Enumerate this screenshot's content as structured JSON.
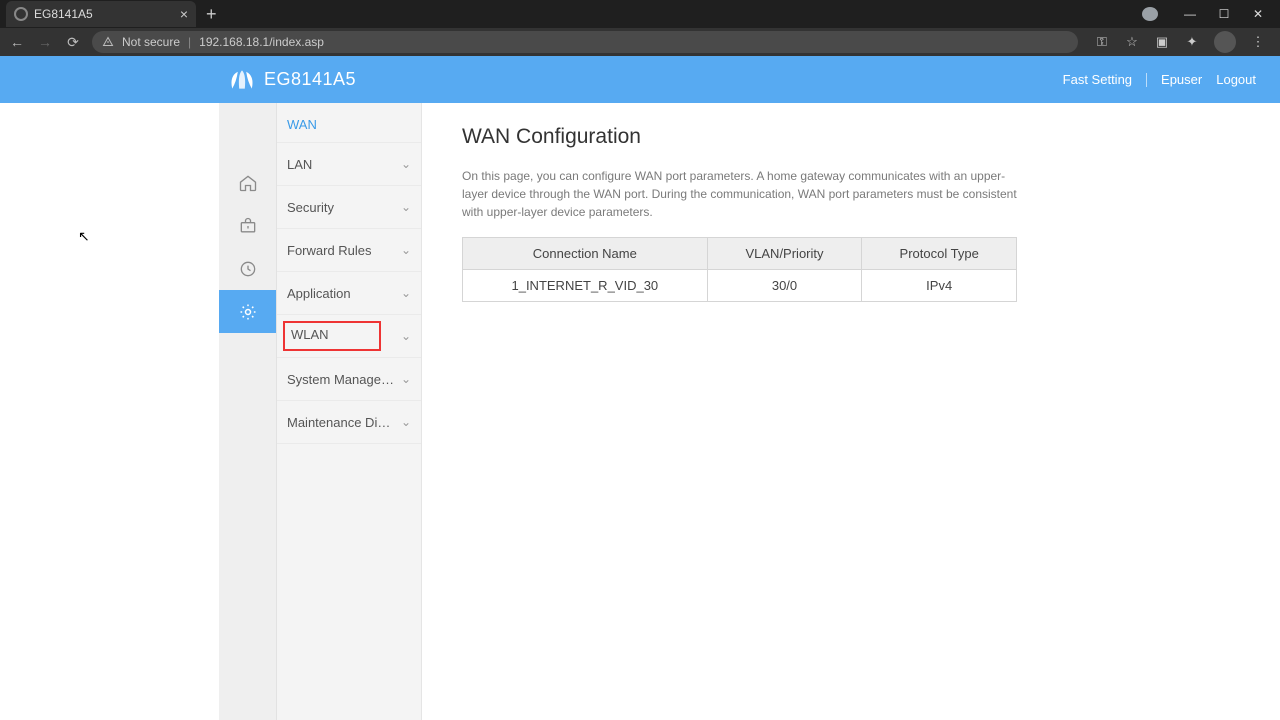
{
  "browser": {
    "tab_title": "EG8141A5",
    "security_label": "Not secure",
    "url": "192.168.18.1/index.asp"
  },
  "header": {
    "device": "EG8141A5",
    "links": {
      "fast": "Fast Setting",
      "user": "Epuser",
      "logout": "Logout"
    }
  },
  "sidenav": {
    "items": [
      {
        "label": "WAN",
        "active": true
      },
      {
        "label": "LAN"
      },
      {
        "label": "Security"
      },
      {
        "label": "Forward Rules"
      },
      {
        "label": "Application"
      },
      {
        "label": "WLAN",
        "highlight": true
      },
      {
        "label": "System Management"
      },
      {
        "label": "Maintenance Diagno.."
      }
    ]
  },
  "page": {
    "title": "WAN Configuration",
    "description": "On this page, you can configure WAN port parameters. A home gateway communicates with an upper-layer device through the WAN port. During the communication, WAN port parameters must be consistent with upper-layer device parameters."
  },
  "table": {
    "headers": {
      "c1": "Connection Name",
      "c2": "VLAN/Priority",
      "c3": "Protocol Type"
    },
    "row": {
      "c1": "1_INTERNET_R_VID_30",
      "c2": "30/0",
      "c3": "IPv4"
    }
  }
}
